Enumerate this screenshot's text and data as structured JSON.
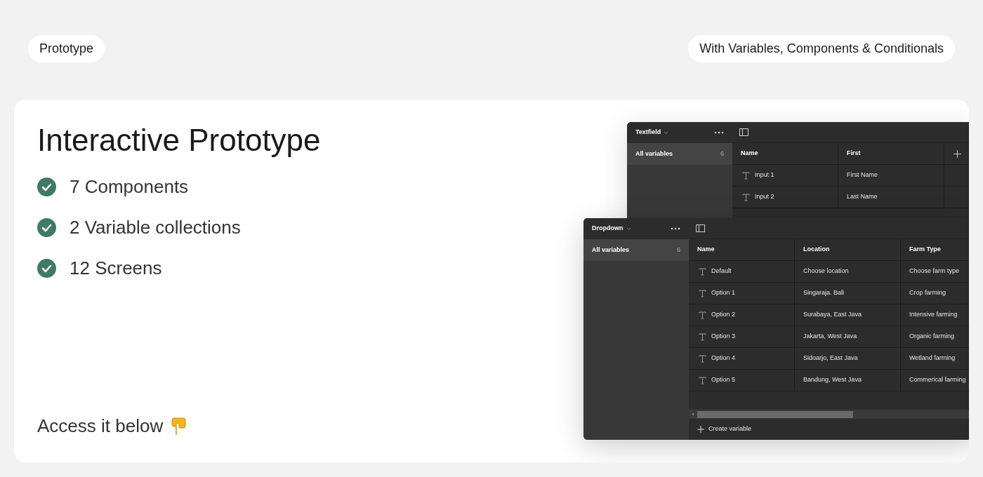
{
  "badges": {
    "left": "Prototype",
    "right": "With Variables, Components & Conditionals"
  },
  "card": {
    "title": "Interactive Prototype",
    "features": [
      {
        "label": "7 Components",
        "checked": true
      },
      {
        "label": "2 Variable collections",
        "checked": true
      },
      {
        "label": "12 Screens",
        "checked": true
      }
    ],
    "footer": "Access it below"
  },
  "panels": [
    {
      "collection": "Textfield",
      "sidebar_item": {
        "label": "All variables",
        "count": "6",
        "selected": true
      },
      "columns": [
        "Name",
        "First"
      ],
      "rows": [
        {
          "name": "Input 1",
          "values": [
            "First Name"
          ]
        },
        {
          "name": "Input 2",
          "values": [
            "Last Name"
          ]
        }
      ]
    },
    {
      "collection": "Dropdown",
      "sidebar_item": {
        "label": "All variables",
        "count": "6",
        "selected": true
      },
      "columns": [
        "Name",
        "Location",
        "Farm Type"
      ],
      "rows": [
        {
          "name": "Default",
          "values": [
            "Choose location",
            "Choose farm type"
          ]
        },
        {
          "name": "Option 1",
          "values": [
            "Singaraja. Bali",
            "Crop farming"
          ]
        },
        {
          "name": "Option 2",
          "values": [
            "Surabaya, East Java",
            "Intensive farming"
          ]
        },
        {
          "name": "Option 3",
          "values": [
            "Jakarta, West Java",
            "Organic farming"
          ]
        },
        {
          "name": "Option 4",
          "values": [
            "Sidoarjo, East Java",
            "Wetland farming"
          ]
        },
        {
          "name": "Option 5",
          "values": [
            "Bandung, West Java",
            "Commerical farming"
          ]
        }
      ],
      "create_label": "Create variable"
    }
  ]
}
